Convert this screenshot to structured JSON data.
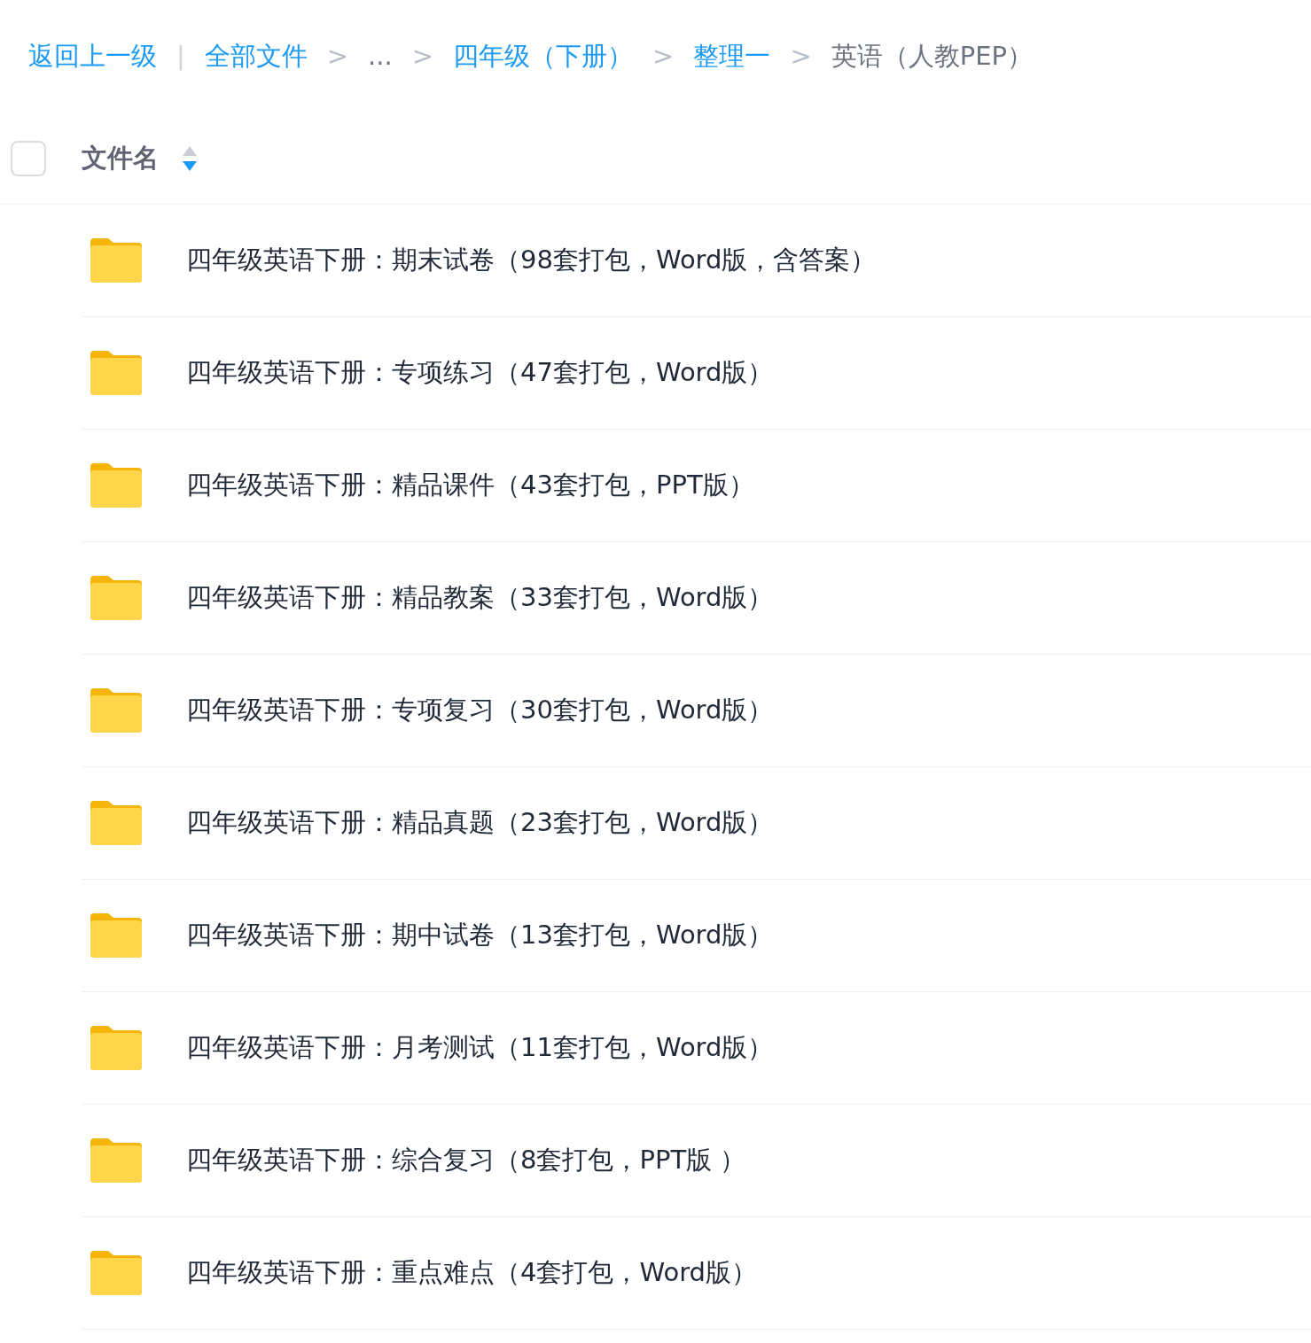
{
  "breadcrumb": {
    "back": "返回上一级",
    "divider": "|",
    "crumbs": [
      {
        "label": "全部文件",
        "kind": "link"
      },
      {
        "label": "...",
        "kind": "ellipsis",
        "separator": ">"
      },
      {
        "label": "四年级（下册）",
        "kind": "link",
        "separator": ">"
      },
      {
        "label": "整理一",
        "kind": "link",
        "separator": ">"
      },
      {
        "label": "英语（人教PEP）",
        "kind": "current",
        "separator": ">"
      }
    ]
  },
  "header": {
    "checked": false,
    "column": "文件名",
    "sort_descending": true
  },
  "files": [
    {
      "name": "四年级英语下册：期末试卷（98套打包，Word版，含答案）"
    },
    {
      "name": "四年级英语下册：专项练习（47套打包，Word版）"
    },
    {
      "name": "四年级英语下册：精品课件（43套打包，PPT版）"
    },
    {
      "name": "四年级英语下册：精品教案（33套打包，Word版）"
    },
    {
      "name": "四年级英语下册：专项复习（30套打包，Word版）"
    },
    {
      "name": "四年级英语下册：精品真题（23套打包，Word版）"
    },
    {
      "name": "四年级英语下册：期中试卷（13套打包，Word版）"
    },
    {
      "name": "四年级英语下册：月考测试（11套打包，Word版）"
    },
    {
      "name": "四年级英语下册：综合复习（8套打包，PPT版 ）"
    },
    {
      "name": "四年级英语下册：重点难点（4套打包，Word版）"
    }
  ]
}
